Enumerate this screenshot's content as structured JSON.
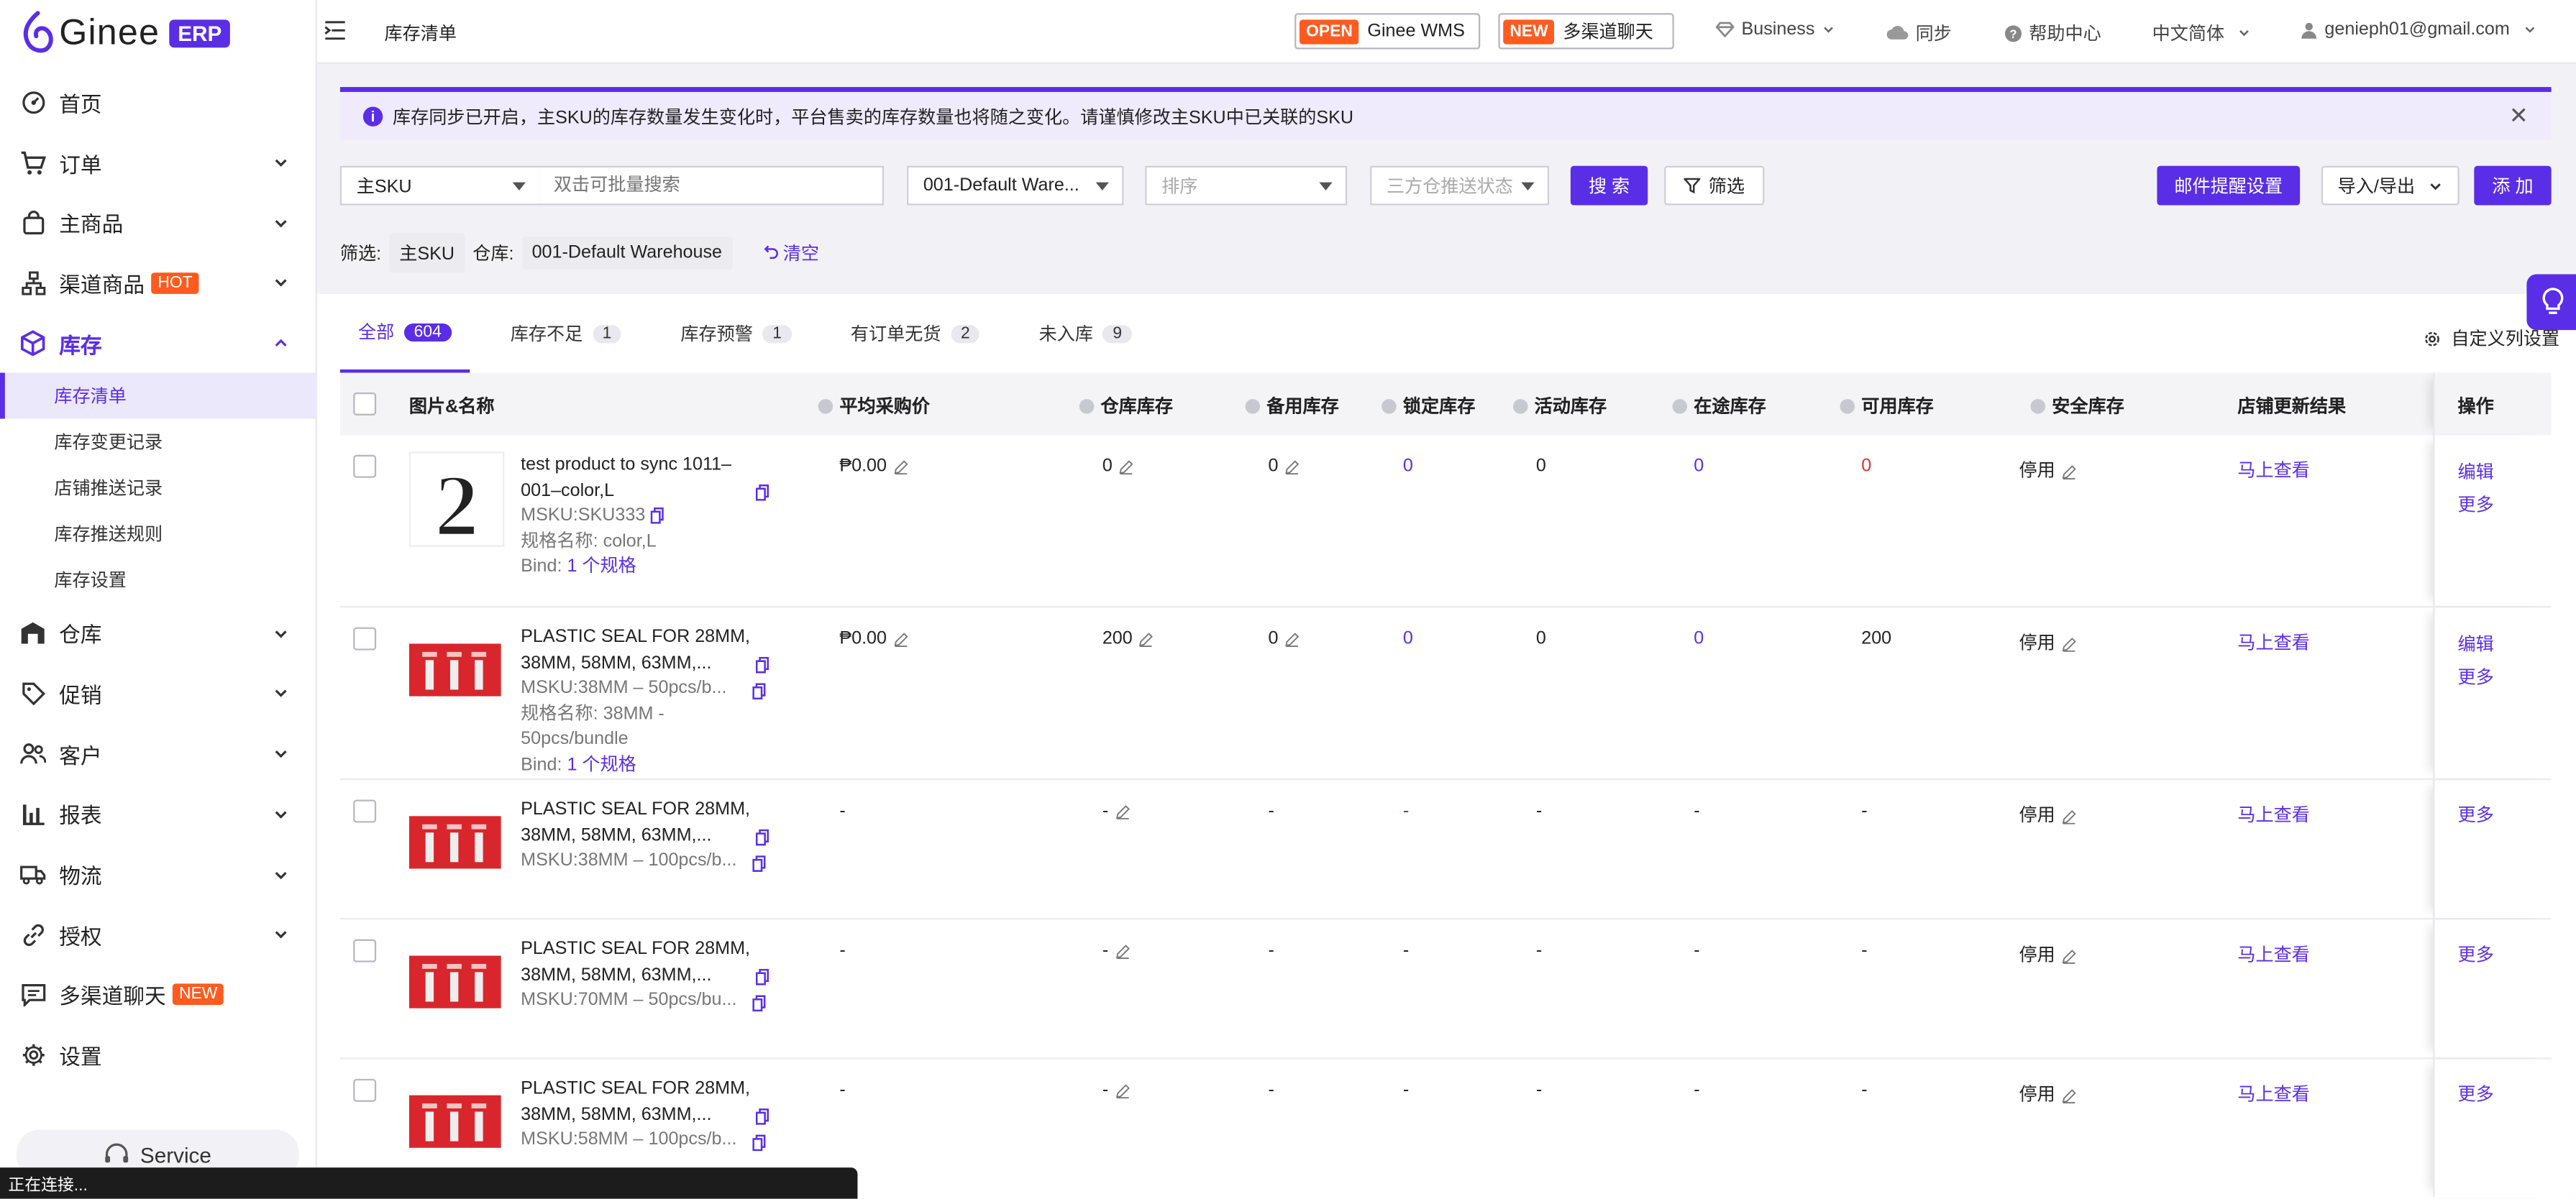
{
  "app": {
    "logo_text": "Ginee",
    "logo_badge": "ERP"
  },
  "sidebar": {
    "items": [
      {
        "label": "首页",
        "icon": "dashboard-icon"
      },
      {
        "label": "订单",
        "icon": "cart-icon"
      },
      {
        "label": "主商品",
        "icon": "bag-icon"
      },
      {
        "label": "渠道商品",
        "icon": "channel-icon",
        "tag": "HOT"
      },
      {
        "label": "库存",
        "icon": "cube-icon"
      },
      {
        "label": "仓库",
        "icon": "warehouse-icon"
      },
      {
        "label": "促销",
        "icon": "tag-icon"
      },
      {
        "label": "客户",
        "icon": "users-icon"
      },
      {
        "label": "报表",
        "icon": "chart-icon"
      },
      {
        "label": "物流",
        "icon": "truck-icon"
      },
      {
        "label": "授权",
        "icon": "link-icon"
      },
      {
        "label": "多渠道聊天",
        "icon": "chat-icon",
        "tag": "NEW"
      },
      {
        "label": "设置",
        "icon": "gear-icon"
      }
    ],
    "sub_items": [
      "库存清单",
      "库存变更记录",
      "店铺推送记录",
      "库存推送规则",
      "库存设置"
    ],
    "service": "Service"
  },
  "topbar": {
    "breadcrumb": "库存清单",
    "wms_badge": "OPEN",
    "wms_label": "Ginee WMS",
    "chat_badge": "NEW",
    "chat_label": "多渠道聊天",
    "business": "Business",
    "sync": "同步",
    "help": "帮助中心",
    "language": "中文简体",
    "user": "genieph01@gmail.com"
  },
  "notice": {
    "text": "库存同步已开启，主SKU的库存数量发生变化时，平台售卖的库存数量也将随之变化。请谨慎修改主SKU中已关联的SKU"
  },
  "filters": {
    "sku_type": "主SKU",
    "search_placeholder": "双击可批量搜索",
    "warehouse": "001-Default Ware...",
    "sort_placeholder": "排序",
    "push_status_placeholder": "三方仓推送状态",
    "search_btn": "搜 索",
    "filter_btn": "筛选",
    "email_btn": "邮件提醒设置",
    "import_export_btn": "导入/导出",
    "add_btn": "添 加"
  },
  "active_filters": {
    "label": "筛选:",
    "sku_chip": "主SKU",
    "warehouse_label": "仓库:",
    "warehouse_chip": "001-Default Warehouse",
    "clear": "清空"
  },
  "tabs": [
    {
      "label": "全部",
      "count": "604"
    },
    {
      "label": "库存不足",
      "count": "1"
    },
    {
      "label": "库存预警",
      "count": "1"
    },
    {
      "label": "有订单无货",
      "count": "2"
    },
    {
      "label": "未入库",
      "count": "9"
    }
  ],
  "custom_columns": "自定义列设置",
  "columns": {
    "name": "图片&名称",
    "avg_price": "平均采购价",
    "wh_stock": "仓库库存",
    "spare": "备用库存",
    "locked": "锁定库存",
    "promo": "活动库存",
    "transit": "在途库存",
    "available": "可用库存",
    "safety": "安全库存",
    "store_result": "店铺更新结果",
    "ops": "操作"
  },
  "rows": [
    {
      "name": "test product to sync 1011–001–color,L",
      "msku": "MSKU:SKU333",
      "spec": "规格名称: color,L",
      "bind_prefix": "Bind: ",
      "bind_link": "1 个规格",
      "price": "₱0.00",
      "wh": "0",
      "spare": "0",
      "locked": "0",
      "promo": "0",
      "transit": "0",
      "available": "0",
      "safety": "停用",
      "result": "马上查看",
      "edit": "编辑",
      "more": "更多",
      "thumb": "digit-two"
    },
    {
      "name": "PLASTIC SEAL FOR 28MM, 38MM, 58MM, 63MM,...",
      "msku": "MSKU:38MM – 50pcs/b...",
      "spec": "规格名称: 38MM - 50pcs/bundle",
      "bind_prefix": "Bind: ",
      "bind_link": "1 个规格",
      "price": "₱0.00",
      "wh": "200",
      "spare": "0",
      "locked": "0",
      "promo": "0",
      "transit": "0",
      "available": "200",
      "safety": "停用",
      "result": "马上查看",
      "edit": "编辑",
      "more": "更多",
      "thumb": "seal"
    },
    {
      "name": "PLASTIC SEAL FOR 28MM, 38MM, 58MM, 63MM,...",
      "msku": "MSKU:38MM – 100pcs/b...",
      "price": "-",
      "wh": "-",
      "spare": "-",
      "locked": "-",
      "promo": "-",
      "transit": "-",
      "available": "-",
      "safety": "停用",
      "result": "马上查看",
      "more": "更多",
      "thumb": "seal"
    },
    {
      "name": "PLASTIC SEAL FOR 28MM, 38MM, 58MM, 63MM,...",
      "msku": "MSKU:70MM – 50pcs/bu...",
      "price": "-",
      "wh": "-",
      "spare": "-",
      "locked": "-",
      "promo": "-",
      "transit": "-",
      "available": "-",
      "safety": "停用",
      "result": "马上查看",
      "more": "更多",
      "thumb": "seal"
    },
    {
      "name": "PLASTIC SEAL FOR 28MM, 38MM, 58MM, 63MM,...",
      "msku": "MSKU:58MM – 100pcs/b...",
      "price": "-",
      "wh": "-",
      "spare": "-",
      "locked": "-",
      "promo": "-",
      "transit": "-",
      "available": "-",
      "safety": "停用",
      "result": "马上查看",
      "more": "更多",
      "thumb": "seal"
    }
  ],
  "statusbar": "正在连接...",
  "colors": {
    "accent": "#5a2ee6",
    "hot": "#ff5a1f",
    "danger": "#e03030"
  }
}
